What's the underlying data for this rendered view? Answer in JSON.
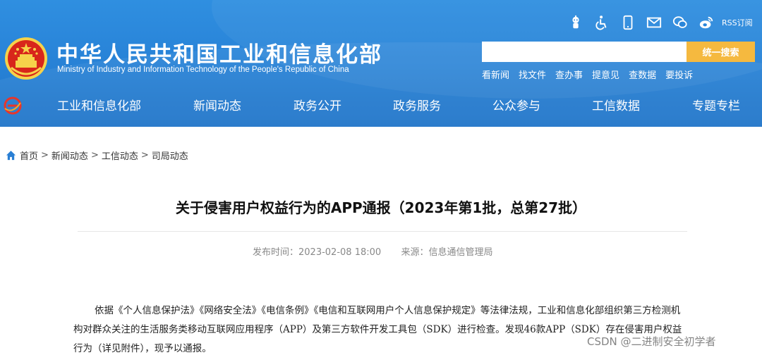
{
  "header": {
    "site_title_cn": "中华人民共和国工业和信息化部",
    "site_title_en": "Ministry of Industry and Information Technology of the People's Republic of China",
    "top_icons": [
      "robot-icon",
      "accessibility-icon",
      "mobile-icon",
      "mail-icon",
      "wechat-icon",
      "weibo-icon"
    ],
    "rss_label": "RSS订阅",
    "search": {
      "value": "",
      "placeholder": "",
      "button_label": "统一搜索"
    },
    "quick_links": [
      "看新闻",
      "找文件",
      "查办事",
      "提意见",
      "查数据",
      "要投诉"
    ],
    "nav": [
      "工业和信息化部",
      "新闻动态",
      "政务公开",
      "政务服务",
      "公众参与",
      "工信数据",
      "专题专栏"
    ]
  },
  "breadcrumb": [
    "首页",
    "新闻动态",
    "工信动态",
    "司局动态"
  ],
  "article": {
    "title": "关于侵害用户权益行为的APP通报（2023年第1批，总第27批）",
    "publish_label": "发布时间：",
    "publish_time": "2023-02-08 18:00",
    "source_label": "来源：",
    "source": "信息通信管理局",
    "paragraph": "依据《个人信息保护法》《网络安全法》《电信条例》《电信和互联网用户个人信息保护规定》等法律法规，工业和信息化部组织第三方检测机构对群众关注的生活服务类移动互联网应用程序（APP）及第三方软件开发工具包（SDK）进行检查。发现46款APP（SDK）存在侵害用户权益行为（详见附件），现予以通报。"
  },
  "watermark": "CSDN @二进制安全初学者",
  "colors": {
    "header_blue": "#2a86da",
    "search_button": "#f5b93f",
    "emblem_red": "#d8261b",
    "emblem_gold": "#f6d24a"
  }
}
